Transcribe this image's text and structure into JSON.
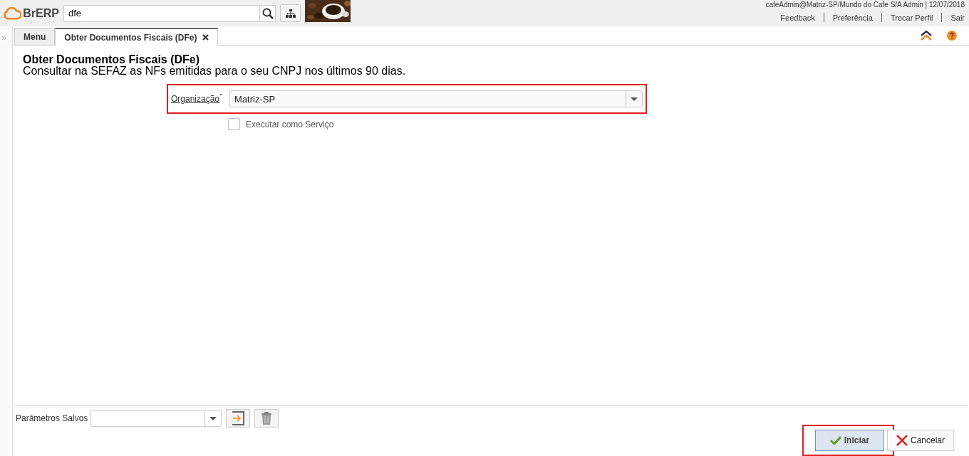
{
  "header": {
    "logo": "BrERP",
    "search": {
      "value": "dfe"
    },
    "user_info": "cafeAdmin@Matriz-SP/Mundo do Cafe S/A Admin | 12/07/2018",
    "links": [
      "Feedback",
      "Preferência",
      "Trocar Perfil",
      "Sair"
    ]
  },
  "sidebar_toggle": "»",
  "tabs": [
    {
      "label": "Menu",
      "selected": false,
      "closable": false
    },
    {
      "label": "Obter Documentos Fiscais (DFe)",
      "selected": true,
      "closable": true
    }
  ],
  "process": {
    "title": "Obter Documentos Fiscais (DFe)",
    "description": "Consultar na SEFAZ as NFs emitidas para o seu CNPJ nos últimos 90 dias.",
    "fields": [
      {
        "kind": "select",
        "label": "Organização",
        "required": true,
        "value": "Matriz-SP",
        "highlighted": true
      },
      {
        "kind": "checkbox",
        "label": "Executar como Serviço",
        "checked": false
      }
    ]
  },
  "footer": {
    "saved_params_label": "Parâmetros Salvos",
    "buttons": [
      {
        "label": "Iniciar",
        "kind": "ok",
        "highlighted": true
      },
      {
        "label": "Cancelar",
        "kind": "cancel",
        "highlighted": false
      }
    ]
  }
}
